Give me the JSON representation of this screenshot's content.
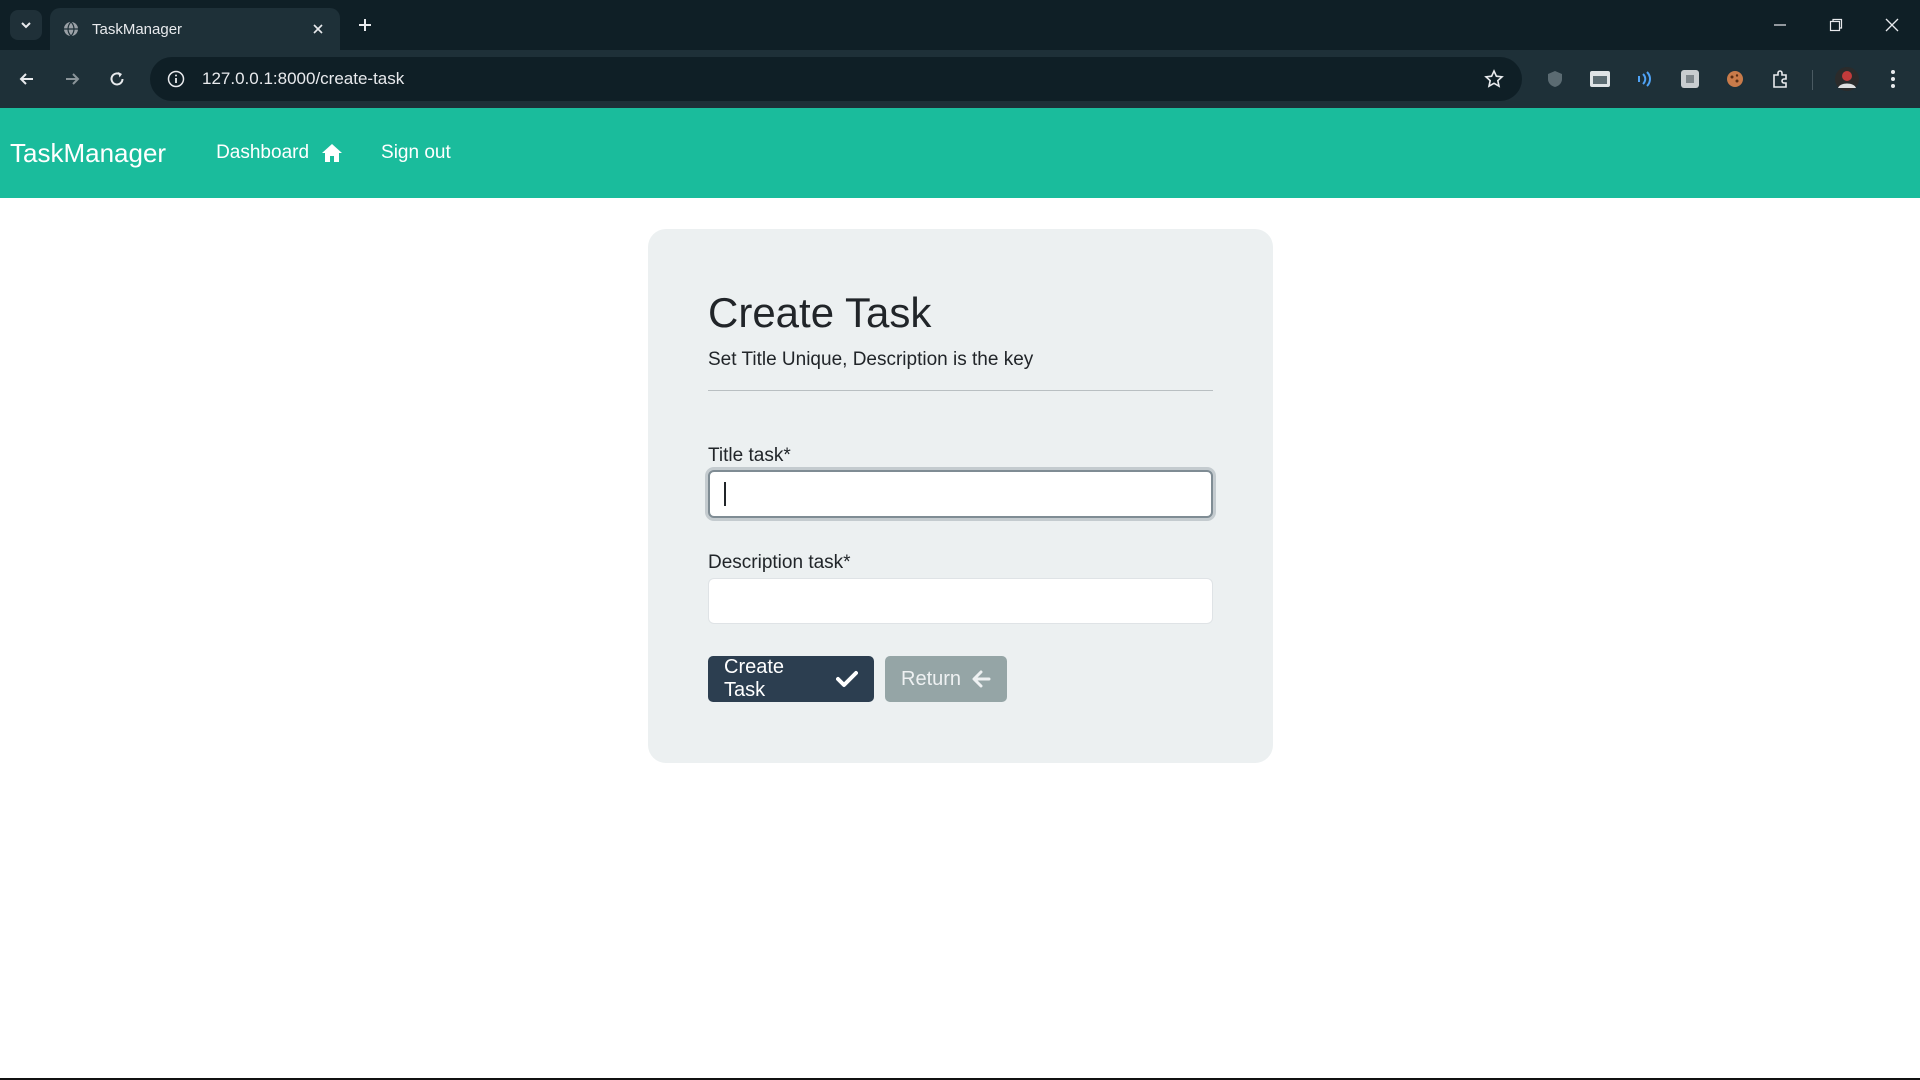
{
  "browser": {
    "tab_title": "TaskManager",
    "url": "127.0.0.1:8000/create-task"
  },
  "navbar": {
    "brand": "TaskManager",
    "dashboard_label": "Dashboard",
    "signout_label": "Sign out"
  },
  "form": {
    "title": "Create Task",
    "subtitle": "Set Title Unique, Description is the key",
    "title_label": "Title task*",
    "title_value": "",
    "description_label": "Description task*",
    "description_value": "",
    "create_button": "Create Task",
    "return_button": "Return"
  },
  "colors": {
    "navbar": "#1abc9c",
    "card": "#ecf0f1",
    "primary_button": "#2c3e50",
    "secondary_button": "#95a5a6"
  }
}
